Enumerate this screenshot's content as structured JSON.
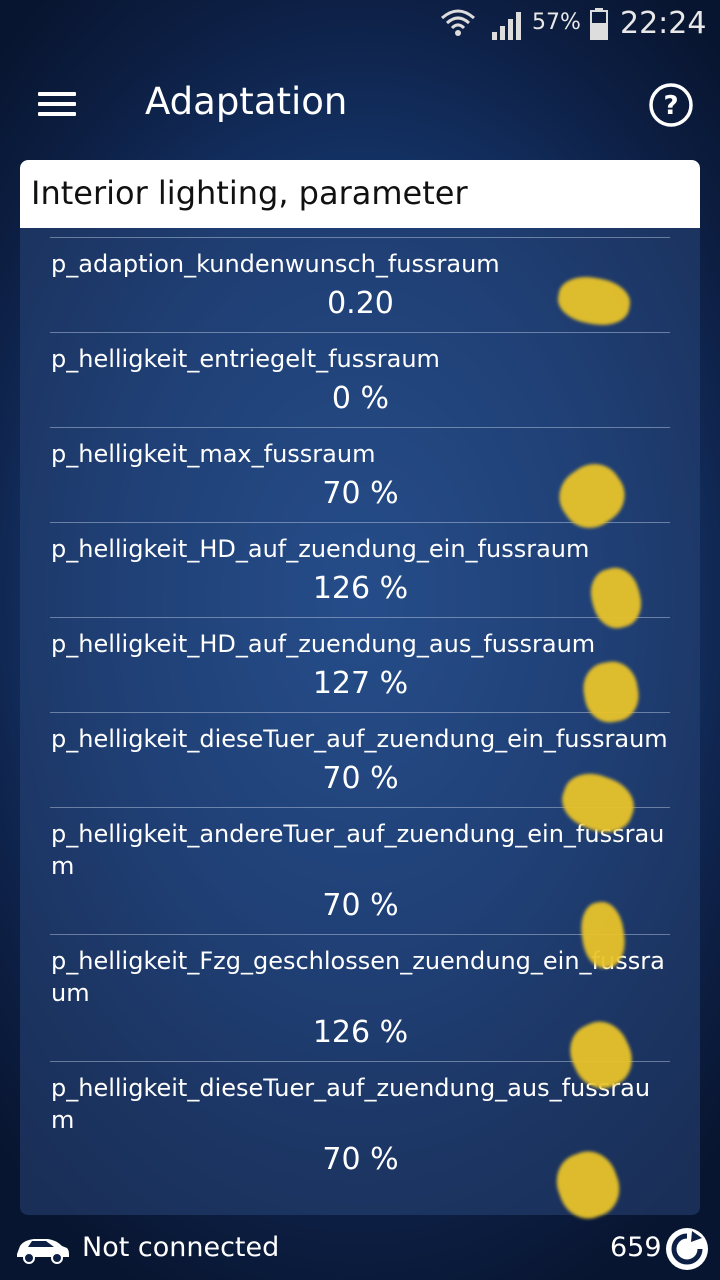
{
  "status_bar": {
    "battery_percent": "57%",
    "time": "22:24",
    "icons": [
      "wifi-icon",
      "signal-icon",
      "battery-icon"
    ]
  },
  "toolbar": {
    "title": "Adaptation",
    "menu_icon": "hamburger-menu-icon",
    "help_icon": "help-circle-icon"
  },
  "panel": {
    "header": "Interior lighting, parameter",
    "rows": [
      {
        "name": "p_adaption_kundenwunsch_fussraum",
        "value": "0.20"
      },
      {
        "name": "p_helligkeit_entriegelt_fussraum",
        "value": "0 %"
      },
      {
        "name": "p_helligkeit_max_fussraum",
        "value": "70 %"
      },
      {
        "name": "p_helligkeit_HD_auf_zuendung_ein_fussraum",
        "value": "126 %"
      },
      {
        "name": "p_helligkeit_HD_auf_zuendung_aus_fussraum",
        "value": "127 %"
      },
      {
        "name": "p_helligkeit_dieseTuer_auf_zuendung_ein_fussraum",
        "value": "70 %"
      },
      {
        "name": "p_helligkeit_andereTuer_auf_zuendung_ein_fussraum",
        "value": "70 %"
      },
      {
        "name": "p_helligkeit_Fzg_geschlossen_zuendung_ein_fussraum",
        "value": "126 %"
      },
      {
        "name": "p_helligkeit_dieseTuer_auf_zuendung_aus_fussraum",
        "value": "70 %"
      }
    ]
  },
  "bottom_bar": {
    "connection_status": "Not connected",
    "count": "659",
    "icons": [
      "car-icon",
      "refresh-icon"
    ]
  },
  "colors": {
    "background_center": "#24579e",
    "background_edge": "#081530",
    "header_bg": "#ffffff",
    "overlay_yellow": "#e8c32a"
  }
}
